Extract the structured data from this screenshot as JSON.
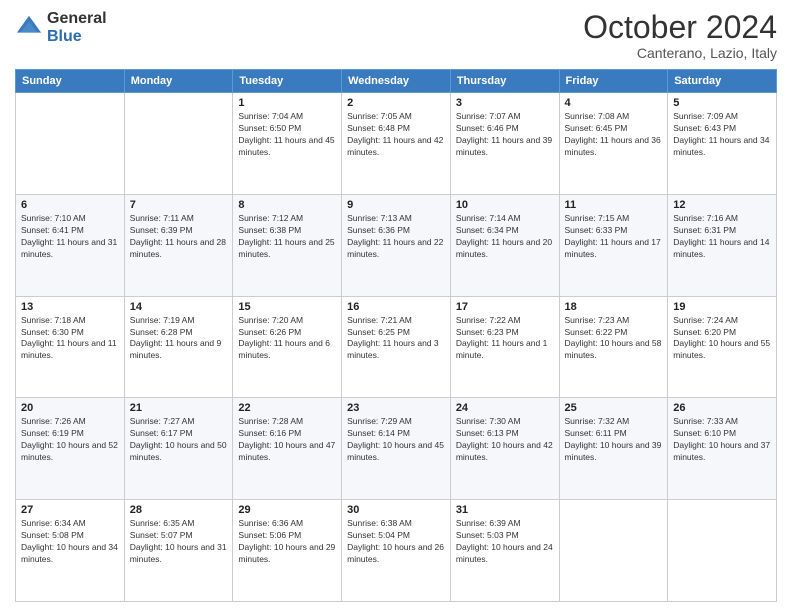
{
  "logo": {
    "general": "General",
    "blue": "Blue"
  },
  "title": "October 2024",
  "subtitle": "Canterano, Lazio, Italy",
  "days_header": [
    "Sunday",
    "Monday",
    "Tuesday",
    "Wednesday",
    "Thursday",
    "Friday",
    "Saturday"
  ],
  "weeks": [
    [
      {
        "day": "",
        "info": ""
      },
      {
        "day": "",
        "info": ""
      },
      {
        "day": "1",
        "info": "Sunrise: 7:04 AM\nSunset: 6:50 PM\nDaylight: 11 hours and 45 minutes."
      },
      {
        "day": "2",
        "info": "Sunrise: 7:05 AM\nSunset: 6:48 PM\nDaylight: 11 hours and 42 minutes."
      },
      {
        "day": "3",
        "info": "Sunrise: 7:07 AM\nSunset: 6:46 PM\nDaylight: 11 hours and 39 minutes."
      },
      {
        "day": "4",
        "info": "Sunrise: 7:08 AM\nSunset: 6:45 PM\nDaylight: 11 hours and 36 minutes."
      },
      {
        "day": "5",
        "info": "Sunrise: 7:09 AM\nSunset: 6:43 PM\nDaylight: 11 hours and 34 minutes."
      }
    ],
    [
      {
        "day": "6",
        "info": "Sunrise: 7:10 AM\nSunset: 6:41 PM\nDaylight: 11 hours and 31 minutes."
      },
      {
        "day": "7",
        "info": "Sunrise: 7:11 AM\nSunset: 6:39 PM\nDaylight: 11 hours and 28 minutes."
      },
      {
        "day": "8",
        "info": "Sunrise: 7:12 AM\nSunset: 6:38 PM\nDaylight: 11 hours and 25 minutes."
      },
      {
        "day": "9",
        "info": "Sunrise: 7:13 AM\nSunset: 6:36 PM\nDaylight: 11 hours and 22 minutes."
      },
      {
        "day": "10",
        "info": "Sunrise: 7:14 AM\nSunset: 6:34 PM\nDaylight: 11 hours and 20 minutes."
      },
      {
        "day": "11",
        "info": "Sunrise: 7:15 AM\nSunset: 6:33 PM\nDaylight: 11 hours and 17 minutes."
      },
      {
        "day": "12",
        "info": "Sunrise: 7:16 AM\nSunset: 6:31 PM\nDaylight: 11 hours and 14 minutes."
      }
    ],
    [
      {
        "day": "13",
        "info": "Sunrise: 7:18 AM\nSunset: 6:30 PM\nDaylight: 11 hours and 11 minutes."
      },
      {
        "day": "14",
        "info": "Sunrise: 7:19 AM\nSunset: 6:28 PM\nDaylight: 11 hours and 9 minutes."
      },
      {
        "day": "15",
        "info": "Sunrise: 7:20 AM\nSunset: 6:26 PM\nDaylight: 11 hours and 6 minutes."
      },
      {
        "day": "16",
        "info": "Sunrise: 7:21 AM\nSunset: 6:25 PM\nDaylight: 11 hours and 3 minutes."
      },
      {
        "day": "17",
        "info": "Sunrise: 7:22 AM\nSunset: 6:23 PM\nDaylight: 11 hours and 1 minute."
      },
      {
        "day": "18",
        "info": "Sunrise: 7:23 AM\nSunset: 6:22 PM\nDaylight: 10 hours and 58 minutes."
      },
      {
        "day": "19",
        "info": "Sunrise: 7:24 AM\nSunset: 6:20 PM\nDaylight: 10 hours and 55 minutes."
      }
    ],
    [
      {
        "day": "20",
        "info": "Sunrise: 7:26 AM\nSunset: 6:19 PM\nDaylight: 10 hours and 52 minutes."
      },
      {
        "day": "21",
        "info": "Sunrise: 7:27 AM\nSunset: 6:17 PM\nDaylight: 10 hours and 50 minutes."
      },
      {
        "day": "22",
        "info": "Sunrise: 7:28 AM\nSunset: 6:16 PM\nDaylight: 10 hours and 47 minutes."
      },
      {
        "day": "23",
        "info": "Sunrise: 7:29 AM\nSunset: 6:14 PM\nDaylight: 10 hours and 45 minutes."
      },
      {
        "day": "24",
        "info": "Sunrise: 7:30 AM\nSunset: 6:13 PM\nDaylight: 10 hours and 42 minutes."
      },
      {
        "day": "25",
        "info": "Sunrise: 7:32 AM\nSunset: 6:11 PM\nDaylight: 10 hours and 39 minutes."
      },
      {
        "day": "26",
        "info": "Sunrise: 7:33 AM\nSunset: 6:10 PM\nDaylight: 10 hours and 37 minutes."
      }
    ],
    [
      {
        "day": "27",
        "info": "Sunrise: 6:34 AM\nSunset: 5:08 PM\nDaylight: 10 hours and 34 minutes."
      },
      {
        "day": "28",
        "info": "Sunrise: 6:35 AM\nSunset: 5:07 PM\nDaylight: 10 hours and 31 minutes."
      },
      {
        "day": "29",
        "info": "Sunrise: 6:36 AM\nSunset: 5:06 PM\nDaylight: 10 hours and 29 minutes."
      },
      {
        "day": "30",
        "info": "Sunrise: 6:38 AM\nSunset: 5:04 PM\nDaylight: 10 hours and 26 minutes."
      },
      {
        "day": "31",
        "info": "Sunrise: 6:39 AM\nSunset: 5:03 PM\nDaylight: 10 hours and 24 minutes."
      },
      {
        "day": "",
        "info": ""
      },
      {
        "day": "",
        "info": ""
      }
    ]
  ]
}
